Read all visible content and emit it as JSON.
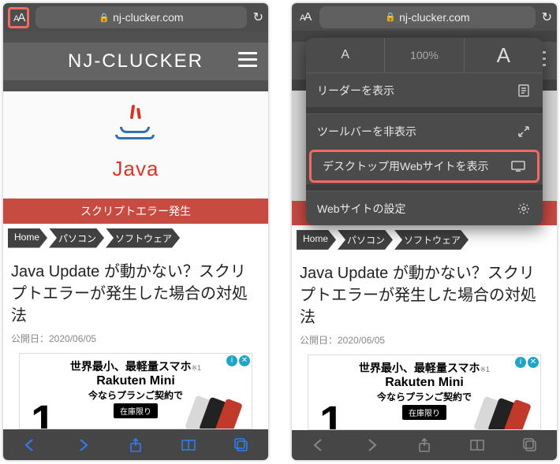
{
  "addr": {
    "url": "nj-clucker.com",
    "textsize_label": "A"
  },
  "site": {
    "title": "NJ-CLUCKER"
  },
  "hero": {
    "logo_text": "Java"
  },
  "error_bar": "スクリプトエラー発生",
  "breadcrumbs": [
    "Home",
    "パソコン",
    "ソフトウェア"
  ],
  "article": {
    "title": "Java Update が動かない？スクリプトエラーが発生した場合の対処法",
    "date_label": "公開日：2020/06/05"
  },
  "ad": {
    "line1": "世界最小、最軽量スマホ",
    "note": "※1",
    "line2": "Rakuten Mini",
    "line3": "今ならプランご契約で",
    "btn": "在庫限り",
    "big": "1"
  },
  "menu": {
    "zoom_percent": "100%",
    "zoom_small": "A",
    "zoom_large": "A",
    "items": {
      "reader": "リーダーを表示",
      "hide_toolbar": "ツールバーを非表示",
      "desktop_site": "デスクトップ用Webサイトを表示",
      "site_settings": "Webサイトの設定"
    }
  }
}
